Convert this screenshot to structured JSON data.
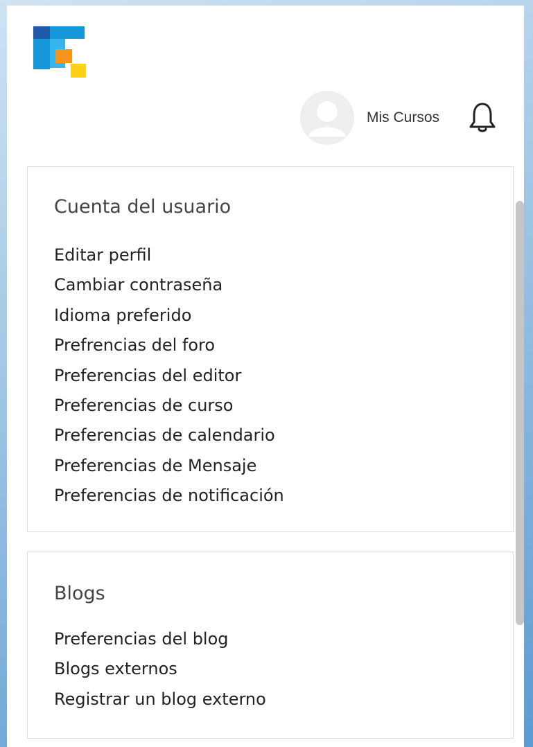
{
  "header": {
    "logo_name": "brand-logo",
    "user_menu_label": "Mis Cursos",
    "notification_icon": "bell-icon"
  },
  "brand_colors": {
    "dark_blue": "#1e5aa8",
    "blue": "#1596d8",
    "light_blue": "#36b4ee",
    "orange": "#f7941d",
    "yellow": "#fcd116"
  },
  "account_section": {
    "title": "Cuenta del usuario",
    "links": [
      {
        "label": "Editar perfil"
      },
      {
        "label": "Cambiar contraseña"
      },
      {
        "label": "Idioma preferido"
      },
      {
        "label": "Prefrencias del foro"
      },
      {
        "label": "Preferencias del editor"
      },
      {
        "label": "Preferencias de curso"
      },
      {
        "label": "Preferencias de calendario"
      },
      {
        "label": "Preferencias de Mensaje"
      },
      {
        "label": "Preferencias de notificación"
      }
    ]
  },
  "blogs_section": {
    "title": "Blogs",
    "links": [
      {
        "label": "Preferencias del blog"
      },
      {
        "label": "Blogs externos"
      },
      {
        "label": "Registrar un blog externo"
      }
    ]
  }
}
